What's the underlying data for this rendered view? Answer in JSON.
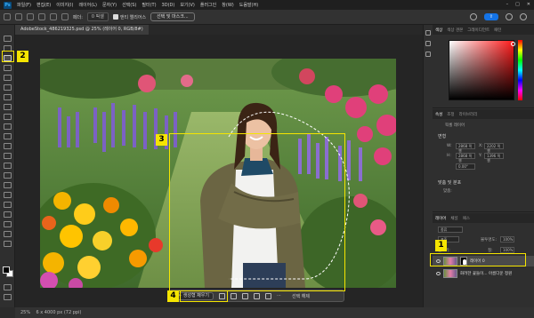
{
  "menu": [
    "파일(F)",
    "편집(E)",
    "이미지(I)",
    "레이어(L)",
    "문자(Y)",
    "선택(S)",
    "필터(T)",
    "3D(D)",
    "보기(V)",
    "플러그인",
    "창(W)",
    "도움말(H)"
  ],
  "options": {
    "feather_label": "페더:",
    "feather_value": "0 픽셀",
    "antialias_label": "앤티 앨리어스",
    "select_mask_button": "선택 및 마스크..."
  },
  "document": {
    "tab_title": "AdobeStock_486219325.psd @ 25% (레이어 0, RGB/8#)"
  },
  "contextual_bar": {
    "generative_fill": "생성형 채우기",
    "deselect": "선택 해제"
  },
  "status": {
    "zoom": "25%",
    "doc_info": "6 x 4000 px (72 ppi)"
  },
  "panels": {
    "color_tabs": [
      "색상",
      "색상 견본",
      "그레이디언트",
      "패턴"
    ],
    "props_tabs": [
      "속성",
      "조정",
      "라이브러리"
    ],
    "props_type": "픽셀 레이어",
    "transform_title": "변형",
    "w_label": "W:",
    "w_value": "2868 픽셀",
    "h_label": "H:",
    "h_value": "2868 픽셀",
    "x_value": "2202 픽셀",
    "y_value": "1396 픽셀",
    "angle_value": "0.00°",
    "align_title": "맞춤 및 분포",
    "align_sub": "맞춤:",
    "layers_tabs": [
      "레이어",
      "채널",
      "패스"
    ],
    "search_kind": "종류",
    "blend_mode": "표준",
    "opacity_label": "불투명도:",
    "opacity_value": "100%",
    "lock_label": "잠그기:",
    "fill_label": "칠:",
    "fill_value": "100%",
    "layers": [
      {
        "name": "레이어 0",
        "selected": true
      },
      {
        "name": "화려한 꽃들이... 아름다운 정원",
        "selected": false
      }
    ]
  },
  "badges": [
    "1",
    "2",
    "3",
    "4"
  ],
  "colors": {
    "accent": "#f5e500",
    "share": "#1473e6"
  }
}
